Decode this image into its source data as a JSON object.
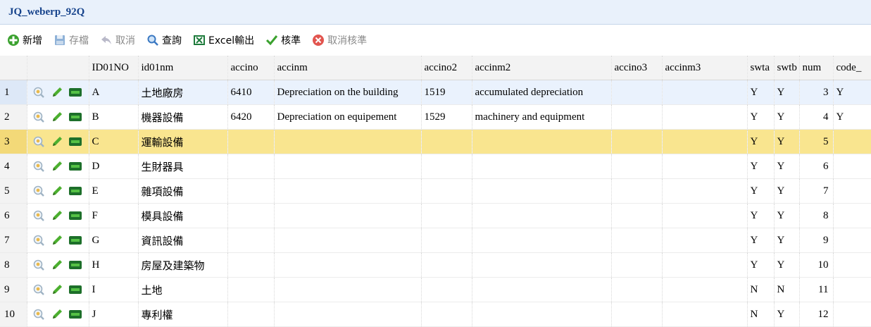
{
  "window": {
    "title": "JQ_weberp_92Q"
  },
  "toolbar": {
    "add": "新增",
    "save": "存檔",
    "cancel": "取消",
    "query": "查詢",
    "excel": "Excel輸出",
    "approve": "核準",
    "unapprove": "取消核準"
  },
  "columns": [
    "",
    "",
    "ID01NO",
    "id01nm",
    "accino",
    "accinm",
    "accino2",
    "accinm2",
    "accino3",
    "accinm3",
    "swta",
    "swtb",
    "num",
    "code_"
  ],
  "rows": [
    {
      "rn": "1",
      "id": "A",
      "nm": "土地廠房",
      "accino": "6410",
      "accinm": "Depreciation on the building",
      "accino2": "1519",
      "accinm2": "accumulated depreciation",
      "accino3": "",
      "accinm3": "",
      "swta": "Y",
      "swtb": "Y",
      "num": "3",
      "code": "Y"
    },
    {
      "rn": "2",
      "id": "B",
      "nm": "機器設備",
      "accino": "6420",
      "accinm": "Depreciation on equipement",
      "accino2": "1529",
      "accinm2": "machinery and equipment",
      "accino3": "",
      "accinm3": "",
      "swta": "Y",
      "swtb": "Y",
      "num": "4",
      "code": "Y"
    },
    {
      "rn": "3",
      "id": "C",
      "nm": "運輸設備",
      "accino": "",
      "accinm": "",
      "accino2": "",
      "accinm2": "",
      "accino3": "",
      "accinm3": "",
      "swta": "Y",
      "swtb": "Y",
      "num": "5",
      "code": ""
    },
    {
      "rn": "4",
      "id": "D",
      "nm": "生財器具",
      "accino": "",
      "accinm": "",
      "accino2": "",
      "accinm2": "",
      "accino3": "",
      "accinm3": "",
      "swta": "Y",
      "swtb": "Y",
      "num": "6",
      "code": ""
    },
    {
      "rn": "5",
      "id": "E",
      "nm": "雜項設備",
      "accino": "",
      "accinm": "",
      "accino2": "",
      "accinm2": "",
      "accino3": "",
      "accinm3": "",
      "swta": "Y",
      "swtb": "Y",
      "num": "7",
      "code": ""
    },
    {
      "rn": "6",
      "id": "F",
      "nm": "模具設備",
      "accino": "",
      "accinm": "",
      "accino2": "",
      "accinm2": "",
      "accino3": "",
      "accinm3": "",
      "swta": "Y",
      "swtb": "Y",
      "num": "8",
      "code": ""
    },
    {
      "rn": "7",
      "id": "G",
      "nm": "資訊設備",
      "accino": "",
      "accinm": "",
      "accino2": "",
      "accinm2": "",
      "accino3": "",
      "accinm3": "",
      "swta": "Y",
      "swtb": "Y",
      "num": "9",
      "code": ""
    },
    {
      "rn": "8",
      "id": "H",
      "nm": "房屋及建築物",
      "accino": "",
      "accinm": "",
      "accino2": "",
      "accinm2": "",
      "accino3": "",
      "accinm3": "",
      "swta": "Y",
      "swtb": "Y",
      "num": "10",
      "code": ""
    },
    {
      "rn": "9",
      "id": "I",
      "nm": "土地",
      "accino": "",
      "accinm": "",
      "accino2": "",
      "accinm2": "",
      "accino3": "",
      "accinm3": "",
      "swta": "N",
      "swtb": "N",
      "num": "11",
      "code": ""
    },
    {
      "rn": "10",
      "id": "J",
      "nm": "專利權",
      "accino": "",
      "accinm": "",
      "accino2": "",
      "accinm2": "",
      "accino3": "",
      "accinm3": "",
      "swta": "N",
      "swtb": "Y",
      "num": "12",
      "code": ""
    }
  ],
  "colors": {
    "accent": "#15428b",
    "highlight": "#f9e58f",
    "selected": "#eaf2fd"
  }
}
